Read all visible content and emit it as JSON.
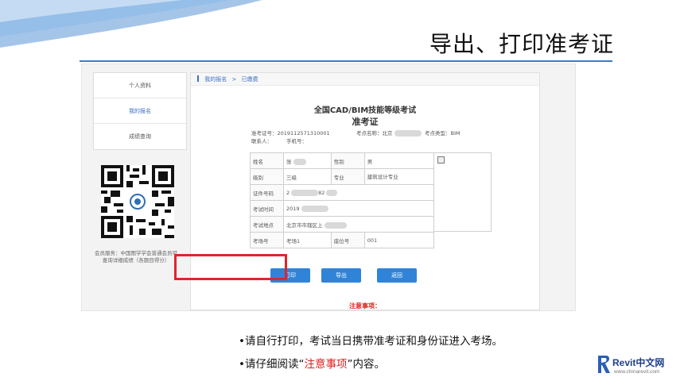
{
  "slide": {
    "title": "导出、打印准考证",
    "bullet1": "•请自行打印，考试当日携带准考证和身份证进入考场。",
    "bullet2_prefix": "•请仔细阅读“",
    "bullet2_highlight": "注意事项",
    "bullet2_suffix": "”内容。"
  },
  "sidebar": {
    "items": [
      {
        "label": "个人资料"
      },
      {
        "label": "我的报名"
      },
      {
        "label": "成绩查询"
      }
    ],
    "member_note": "会员服务：中国图学学会普通会员可查询详细成绩（各题目得分）"
  },
  "breadcrumb": {
    "root": "我的报名",
    "separator": ">",
    "current": "已缴费"
  },
  "ticket": {
    "exam_name": "全国CAD/BIM技能等级考试",
    "title": "准考证",
    "ticket_no": "准考证号：2019112571310001",
    "venue_name": "考点名称：北京",
    "venue_type": "考点类型：BIM",
    "contact": "联系人：",
    "phone": "手机号：",
    "rows": {
      "name_label": "姓名",
      "name_value": "张",
      "gender_label": "性别",
      "gender_value": "男",
      "level_label": "级别",
      "level_value": "三级",
      "major_label": "专业",
      "major_value": "建筑设计专业",
      "id_label": "证件号码",
      "id_value": "2",
      "id_value_tail": "82",
      "time_label": "考试时间",
      "time_value": "2019",
      "place_label": "考试地点",
      "place_value": "北京市市辖区上",
      "room_label": "考场号",
      "room_value": "考场1",
      "seat_label": "座位号",
      "seat_value": "001"
    },
    "buttons": {
      "print": "打印",
      "export": "导出",
      "back": "返回"
    },
    "notice": "注意事项："
  },
  "brand": {
    "name": "Revit中文网",
    "url": "www.chinarevit.com"
  },
  "colors": {
    "accent": "#2f84d8",
    "highlight": "#e1242b",
    "title_rule": "#3b7dc4"
  }
}
